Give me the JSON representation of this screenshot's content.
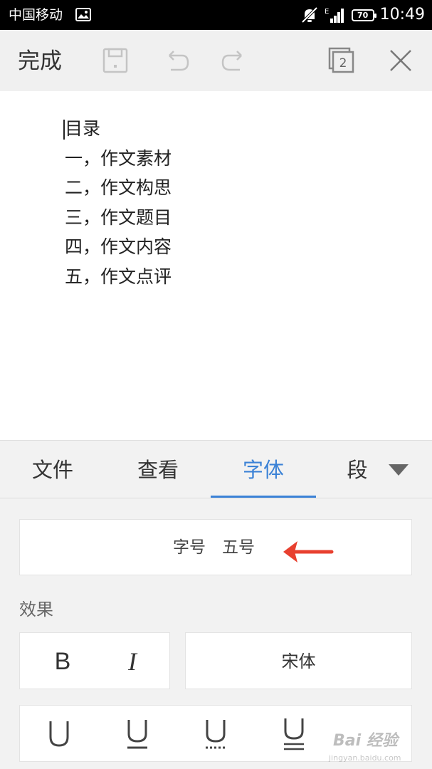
{
  "status_bar": {
    "carrier": "中国移动",
    "network": "E",
    "battery": "70",
    "time": "10:49"
  },
  "toolbar": {
    "done_label": "完成",
    "window_count": "2",
    "icons": [
      "save-icon",
      "undo-icon",
      "redo-icon",
      "windows-icon",
      "close-icon"
    ]
  },
  "document": {
    "lines": [
      "目录",
      "一，作文素材",
      "二，作文构思",
      "三，作文题目",
      "四，作文内容",
      "五，作文点评"
    ]
  },
  "tabs": [
    {
      "label": "文件",
      "active": false
    },
    {
      "label": "查看",
      "active": false
    },
    {
      "label": "字体",
      "active": true
    },
    {
      "label": "段",
      "active": false
    }
  ],
  "font_panel": {
    "font_size_label": "字号",
    "font_size_value": "五号",
    "effects_label": "效果",
    "bold_label": "B",
    "italic_label": "I",
    "font_name": "宋体"
  },
  "colors": {
    "accent": "#3b82d6",
    "annotation_arrow": "#e8402f"
  },
  "watermark": {
    "text": "Bai 经验",
    "url": "jingyan.baidu.com"
  }
}
